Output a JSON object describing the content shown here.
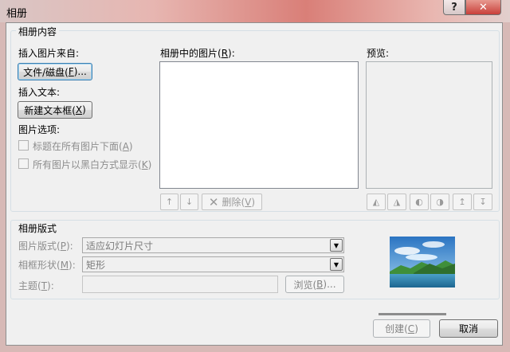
{
  "window": {
    "title": "相册",
    "help": "?",
    "close": "✕"
  },
  "content_group": {
    "title": "相册内容",
    "insert_from_label": "插入图片来自:",
    "file_button": {
      "text": "文件/磁盘(",
      "key": "F",
      "tail": ")..."
    },
    "insert_text_label": "插入文本:",
    "new_textbox_button": {
      "text": "新建文本框(",
      "key": "X",
      "tail": ")"
    },
    "picture_options_label": "图片选项:",
    "option_captions": {
      "text": "标题在所有图片下面(",
      "key": "A",
      "tail": ")"
    },
    "option_bw": {
      "text": "所有图片以黑白方式显示(",
      "key": "K",
      "tail": ")"
    },
    "pictures_label": {
      "text": "相册中的图片(",
      "key": "R",
      "tail": "):"
    },
    "delete_button": {
      "text": "删除(",
      "key": "V",
      "tail": ")"
    },
    "preview_label": "预览:"
  },
  "layout_group": {
    "title": "相册版式",
    "picture_layout": {
      "label": "图片版式(",
      "key": "P",
      "tail": "):",
      "value": "适应幻灯片尺寸"
    },
    "frame_shape": {
      "label": "相框形状(",
      "key": "M",
      "tail": "):",
      "value": "矩形"
    },
    "theme": {
      "label": "主题(",
      "key": "T",
      "tail": "):",
      "value": ""
    },
    "browse_button": {
      "text": "浏览(",
      "key": "B",
      "tail": ")..."
    }
  },
  "footer": {
    "create_button": {
      "text": "创建(",
      "key": "C",
      "tail": ")"
    },
    "cancel_button": "取消"
  },
  "colors": {
    "close_red": "#c9403a",
    "focus_blue": "#3c7fb1"
  }
}
